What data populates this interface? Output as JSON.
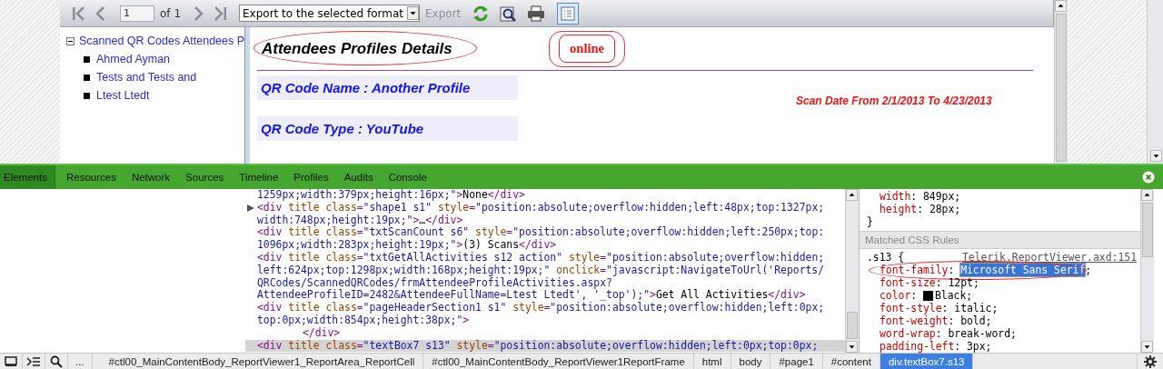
{
  "viewer": {
    "toolbar": {
      "page_input": "1",
      "page_count": "of 1",
      "export_select": "Export to the selected format",
      "export_button": {
        "label": "Export",
        "disabled": true
      },
      "doc_map_toggle": {
        "on": true
      }
    },
    "document_map": [
      {
        "label": "Scanned QR Codes Attendees P",
        "expanded": true,
        "children": [
          {
            "label": "Ahmed Ayman"
          },
          {
            "label": "Tests and Tests and"
          },
          {
            "label": "Ltest Ltedt"
          }
        ]
      }
    ],
    "report": {
      "title": {
        "text": "Attendees Profiles Details",
        "circled": true
      },
      "status_badge": {
        "text": "online",
        "circled": true
      },
      "fields": [
        "QR Code Name : Another Profile",
        "QR Code Type : YouTube"
      ],
      "scan_date": "Scan Date From 2/1/2013 To 4/23/2013"
    }
  },
  "devtools": {
    "tabs": [
      {
        "label": "Elements",
        "selected": true
      },
      {
        "label": "Resources",
        "selected": false
      },
      {
        "label": "Network",
        "selected": false
      },
      {
        "label": "Sources",
        "selected": false
      },
      {
        "label": "Timeline",
        "selected": false
      },
      {
        "label": "Profiles",
        "selected": false
      },
      {
        "label": "Audits",
        "selected": false
      },
      {
        "label": "Console",
        "selected": false
      }
    ],
    "dom_nodes": [
      {
        "starts_inside_value": true,
        "collapsed": false,
        "selected": false,
        "lines": [
          "1259px;width:379px;height:16px;\">None</div>"
        ]
      },
      {
        "starts_inside_value": false,
        "collapsed": true,
        "selected": false,
        "lines": [
          "<div title class=\"shape1 s1\" style=\"position:absolute;overflow:hidden;left:48px;top:1327px;",
          "width:748px;height:19px;\">…</div>"
        ]
      },
      {
        "starts_inside_value": false,
        "collapsed": false,
        "selected": false,
        "lines": [
          "<div title class=\"txtScanCount s6\" style=\"position:absolute;overflow:hidden;left:250px;top:",
          "1096px;width:283px;height:19px;\">(3) Scans</div>"
        ]
      },
      {
        "starts_inside_value": false,
        "collapsed": false,
        "selected": false,
        "lines": [
          "<div title class=\"txtGetAllActivities s12 action\" style=\"position:absolute;overflow:hidden;",
          "left:624px;top:1298px;width:168px;height:19px;\" onclick=\"javascript:NavigateToUrl('Reports/",
          "QRCodes/ScannedQRCodes/frmAttendeeProfileActivities.aspx?",
          "AttendeeProfileID=2482&AttendeeFullName=Ltest Ltedt', '_top');\">Get All Activities</div>"
        ]
      },
      {
        "starts_inside_value": false,
        "collapsed": false,
        "selected": false,
        "lines": [
          "<div title class=\"pageHeaderSection1 s1\" style=\"position:absolute;overflow:hidden;left:0px;",
          "top:0px;width:854px;height:38px;\">"
        ],
        "children": [
          {
            "starts_inside_value": false,
            "collapsed": false,
            "selected": false,
            "lines": [
              "</div>"
            ]
          }
        ]
      },
      {
        "starts_inside_value": false,
        "collapsed": false,
        "selected": true,
        "lines": [
          "<div title class=\"textBox7 s13\" style=\"position:absolute;overflow:hidden;left:0px;top:0px;"
        ]
      }
    ],
    "styles": {
      "previous_rule_properties": [
        {
          "text": "width: 849px;"
        },
        {
          "text": "height: 28px;"
        }
      ],
      "previous_rule_end": "}",
      "section_header": "Matched CSS Rules",
      "rule": {
        "selector": ".s13 {",
        "source": "Telerik.ReportViewer.axd:151",
        "properties": [
          {
            "text": "font-family: Microsoft Sans Serif;",
            "editing": true,
            "circled": true
          },
          {
            "text": "font-size: 12pt;",
            "editing": false,
            "circled": false
          },
          {
            "text": "color: Black;",
            "editing": false,
            "circled": false,
            "color": "#000000"
          },
          {
            "text": "font-style: italic;",
            "editing": false,
            "circled": false
          },
          {
            "text": "font-weight: bold;",
            "editing": false,
            "circled": false
          },
          {
            "text": "word-wrap: break-word;",
            "editing": false,
            "circled": false
          },
          {
            "text": "padding-left: 3px;",
            "editing": false,
            "circled": false
          }
        ]
      }
    },
    "more_button": "...",
    "breadcrumbs": [
      {
        "label": "#ctl00_MainContentBody_ReportViewer1_ReportArea_ReportCell",
        "selected": false
      },
      {
        "label": "#ctl00_MainContentBody_ReportViewer1ReportFrame",
        "selected": false
      },
      {
        "label": "html",
        "selected": false
      },
      {
        "label": "body",
        "selected": false
      },
      {
        "label": "#page1",
        "selected": false
      },
      {
        "label": "#content",
        "selected": false
      },
      {
        "label": "div.textBox7.s13",
        "selected": true
      }
    ]
  }
}
